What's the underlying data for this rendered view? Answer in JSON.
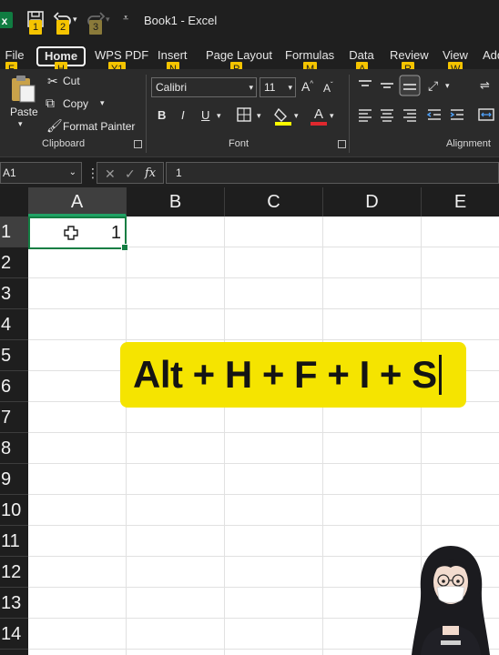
{
  "window": {
    "title": "Book1 - Excel"
  },
  "quick_access": {
    "items": [
      {
        "icon": "excel-logo-icon"
      },
      {
        "icon": "save-icon",
        "keytip": "1"
      },
      {
        "icon": "undo-icon",
        "keytip": "2"
      },
      {
        "icon": "redo-icon",
        "keytip": "3"
      },
      {
        "icon": "customize-icon"
      }
    ]
  },
  "tabs": [
    {
      "label": "File",
      "keytip": "F"
    },
    {
      "label": "Home",
      "keytip": "H",
      "active": true
    },
    {
      "label": "WPS PDF",
      "keytip": "Y1"
    },
    {
      "label": "Insert",
      "keytip": "N"
    },
    {
      "label": "Page Layout",
      "keytip": "P"
    },
    {
      "label": "Formulas",
      "keytip": "M"
    },
    {
      "label": "Data",
      "keytip": "A"
    },
    {
      "label": "Review",
      "keytip": "R"
    },
    {
      "label": "View",
      "keytip": "W"
    },
    {
      "label": "Add"
    }
  ],
  "ribbon": {
    "clipboard": {
      "paste_label": "Paste",
      "cut_label": "Cut",
      "copy_label": "Copy",
      "format_painter_label": "Format Painter",
      "group_label": "Clipboard"
    },
    "font": {
      "font_name": "Calibri",
      "font_size": "11",
      "bold": "B",
      "italic": "I",
      "underline": "U",
      "group_label": "Font"
    },
    "alignment": {
      "group_label": "Alignment"
    }
  },
  "formula_bar": {
    "name_box": "A1",
    "fx_label": "fx",
    "value": "1"
  },
  "grid": {
    "columns": [
      "A",
      "B",
      "C",
      "D",
      "E"
    ],
    "rows": [
      "1",
      "2",
      "3",
      "4",
      "5",
      "6",
      "7",
      "8",
      "9",
      "10",
      "11",
      "12",
      "13",
      "14"
    ],
    "selected_cell": {
      "ref": "A1",
      "value": "1"
    }
  },
  "overlay": {
    "shortcut_text": "Alt + H + F + I + S"
  },
  "colors": {
    "accent_green": "#137e43",
    "keytip_yellow": "#f5c400",
    "overlay_yellow": "#f5e400"
  }
}
